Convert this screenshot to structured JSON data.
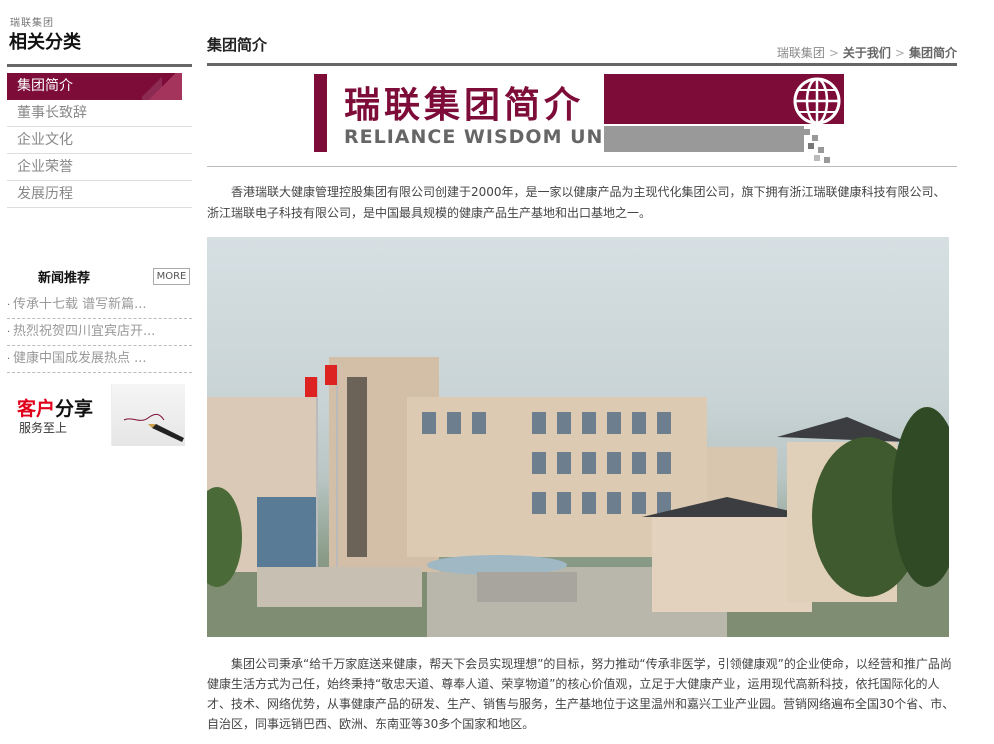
{
  "sidebar": {
    "subtitle": "瑞联集团",
    "title": "相关分类",
    "menu": [
      {
        "label": "集团简介",
        "active": true
      },
      {
        "label": "董事长致辞",
        "active": false
      },
      {
        "label": "企业文化",
        "active": false
      },
      {
        "label": "企业荣誉",
        "active": false
      },
      {
        "label": "发展历程",
        "active": false
      }
    ],
    "news": {
      "title": "新闻推荐",
      "more_label": "MORE",
      "items": [
        "传承十七载 谱写新篇...",
        "热烈祝贺四川宜宾店开...",
        "健康中国成发展热点 ..."
      ]
    },
    "share": {
      "title_red": "客户",
      "title_black": "分享",
      "subtitle": "服务至上"
    }
  },
  "header": {
    "title": "集团简介",
    "breadcrumb": [
      "瑞联集团",
      "关于我们",
      "集团简介"
    ],
    "breadcrumb_sep": ">"
  },
  "banner": {
    "title_cn": "瑞联集团简介",
    "title_en": "RELIANCE WISDOM UNION"
  },
  "content": {
    "intro": "香港瑞联大健康管理控股集团有限公司创建于2000年，是一家以健康产品为主现代化集团公司，旗下拥有浙江瑞联健康科技有限公司、浙江瑞联电子科技有限公司，是中国最具规模的健康产品生产基地和出口基地之一。",
    "body": "集团公司秉承“给千万家庭送来健康，帮天下会员实现理想”的目标，努力推动“传承非医学，引领健康观”的企业使命，以经营和推广品尚健康生活方式为己任，始终秉持“敬忠天道、尊奉人道、荣享物道”的核心价值观，立足于大健康产业，运用现代高新科技，依托国际化的人才、技术、网络优势，从事健康产品的研发、生产、销售与服务，生产基地位于这里温州和嘉兴工业产业园。营销网络遍布全国30个省、市、自治区，同事远销巴西、欧洲、东南亚等30多个国家和地区。"
  },
  "colors": {
    "brand": "#7d0c39",
    "accent_red": "#e0001b"
  }
}
